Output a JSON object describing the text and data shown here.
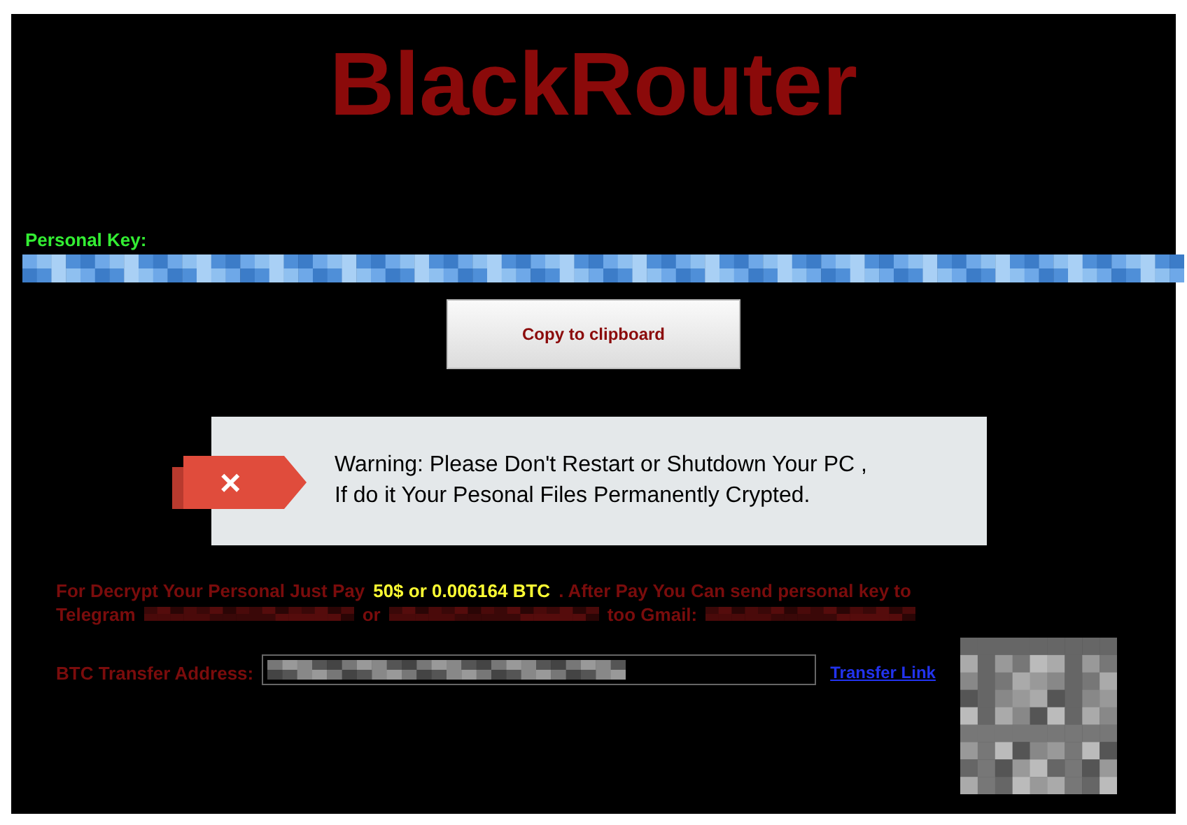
{
  "title": "BlackRouter",
  "personal_key": {
    "label": "Personal Key:"
  },
  "copy_button": {
    "label": "Copy to clipboard"
  },
  "warning": {
    "icon": "×",
    "lines": [
      "Warning: Please Don't Restart or Shutdown Your PC ,",
      "If do it Your Pesonal Files Permanently Crypted."
    ]
  },
  "payment": {
    "lines": [
      [
        {
          "kind": "text",
          "text": "For Decrypt Your Personal Just Pay"
        },
        {
          "kind": "highlight",
          "text": "50$ or 0.006164 BTC"
        },
        {
          "kind": "text",
          "text": ". After Pay You Can send personal key to"
        }
      ],
      [
        {
          "kind": "text",
          "text": "Telegram"
        },
        {
          "kind": "redacted"
        },
        {
          "kind": "text",
          "text": "or"
        },
        {
          "kind": "redacted"
        },
        {
          "kind": "text",
          "text": "too Gmail:"
        },
        {
          "kind": "redacted"
        }
      ]
    ]
  },
  "btc": {
    "label": "BTC Transfer Address:",
    "link": "Transfer Link"
  }
}
